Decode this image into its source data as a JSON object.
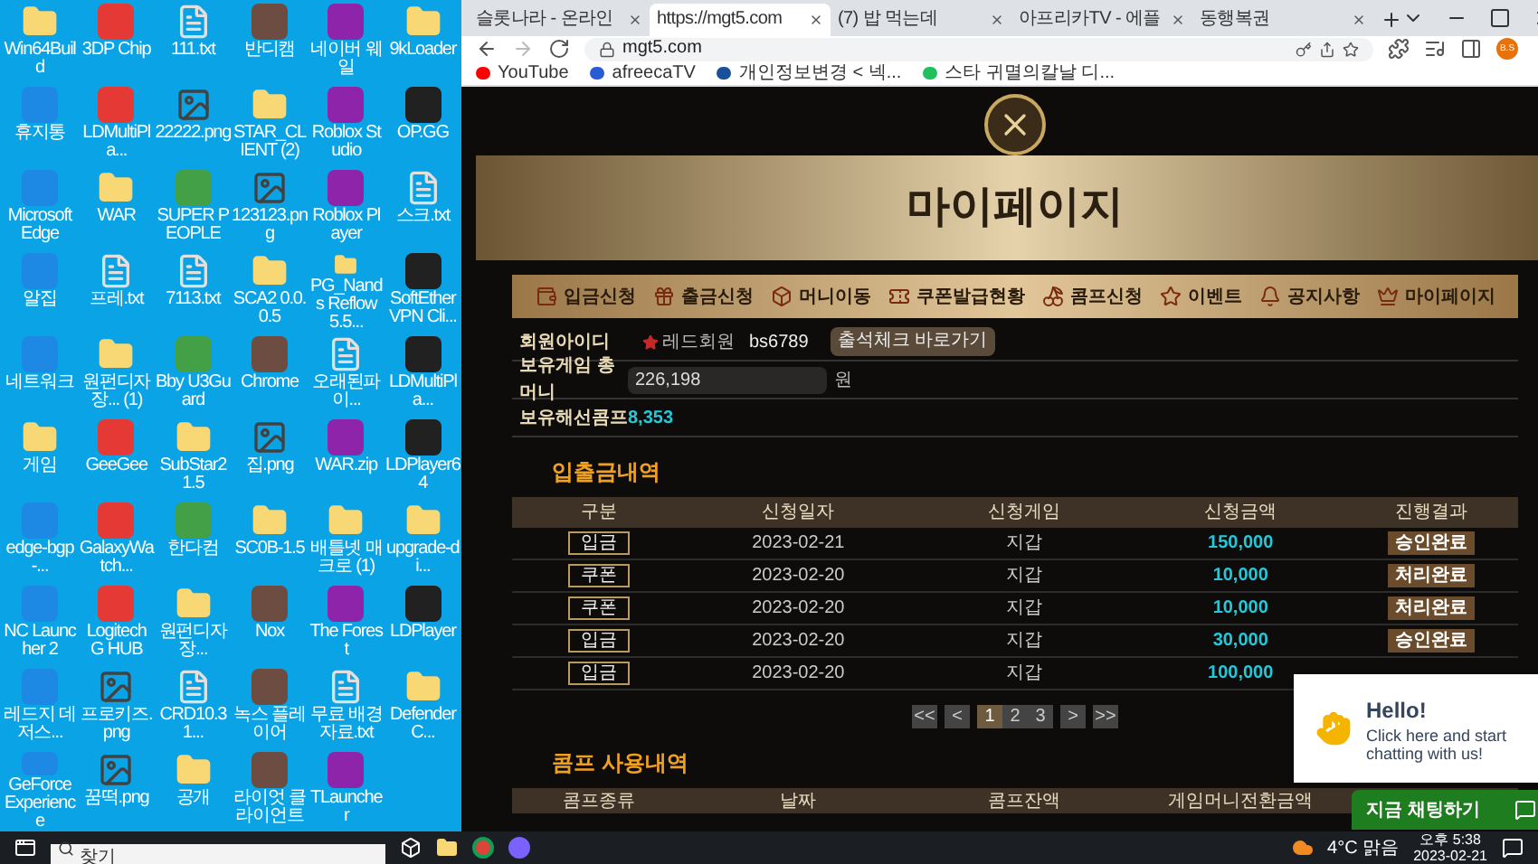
{
  "desktop": {
    "icons": [
      {
        "label": "Win64Build",
        "kind": "folder"
      },
      {
        "label": "3DP Chip",
        "kind": "app"
      },
      {
        "label": "111.txt",
        "kind": "file"
      },
      {
        "label": "반디캠",
        "kind": "app"
      },
      {
        "label": "네이버 웨일",
        "kind": "app"
      },
      {
        "label": "9kLoader",
        "kind": "folder"
      },
      {
        "label": "휴지통",
        "kind": "app"
      },
      {
        "label": "LDMultiPla...",
        "kind": "app"
      },
      {
        "label": "22222.png",
        "kind": "image"
      },
      {
        "label": "STAR_CLIENT (2)",
        "kind": "folder"
      },
      {
        "label": "Roblox Studio",
        "kind": "app"
      },
      {
        "label": "OP.GG",
        "kind": "app"
      },
      {
        "label": "Microsoft Edge",
        "kind": "app"
      },
      {
        "label": "WAR",
        "kind": "folder"
      },
      {
        "label": "SUPER PEOPLE",
        "kind": "app"
      },
      {
        "label": "123123.png",
        "kind": "image"
      },
      {
        "label": "Roblox Player",
        "kind": "app"
      },
      {
        "label": "스크.txt",
        "kind": "file"
      },
      {
        "label": "알집",
        "kind": "app"
      },
      {
        "label": "프레.txt",
        "kind": "file"
      },
      {
        "label": "7113.txt",
        "kind": "file"
      },
      {
        "label": "SCA2 0.0.0.5",
        "kind": "folder"
      },
      {
        "label": "PG_Nands Reflow 5.5...",
        "kind": "folder"
      },
      {
        "label": "SoftEther VPN Cli...",
        "kind": "app"
      },
      {
        "label": "네트워크",
        "kind": "app"
      },
      {
        "label": "원펀디자장... (1)",
        "kind": "folder"
      },
      {
        "label": "Bby U3Guard",
        "kind": "app"
      },
      {
        "label": "Chrome",
        "kind": "app"
      },
      {
        "label": "오래된파이...",
        "kind": "file"
      },
      {
        "label": "LDMultiPla...",
        "kind": "app"
      },
      {
        "label": "게임",
        "kind": "folder"
      },
      {
        "label": "GeeGee",
        "kind": "app"
      },
      {
        "label": "SubStar2 1.5",
        "kind": "folder"
      },
      {
        "label": "집.png",
        "kind": "image"
      },
      {
        "label": "WAR.zip",
        "kind": "app"
      },
      {
        "label": "LDPlayer64",
        "kind": "app"
      },
      {
        "label": "edge-bgp-...",
        "kind": "app"
      },
      {
        "label": "GalaxyWatch...",
        "kind": "app"
      },
      {
        "label": "한다컴",
        "kind": "app"
      },
      {
        "label": "SC0B-1.5",
        "kind": "folder"
      },
      {
        "label": "배틀넷 매크로 (1)",
        "kind": "folder"
      },
      {
        "label": "upgrade-di...",
        "kind": "folder"
      },
      {
        "label": "NC Launcher 2",
        "kind": "app"
      },
      {
        "label": "Logitech G HUB",
        "kind": "app"
      },
      {
        "label": "원펀디자장...",
        "kind": "folder"
      },
      {
        "label": "Nox",
        "kind": "app"
      },
      {
        "label": "The Forest",
        "kind": "app"
      },
      {
        "label": "LDPlayer",
        "kind": "app"
      },
      {
        "label": "레드지 데저스...",
        "kind": "app"
      },
      {
        "label": "프로키즈.png",
        "kind": "image"
      },
      {
        "label": "CRD10.31...",
        "kind": "file"
      },
      {
        "label": "녹스 플레이어",
        "kind": "app"
      },
      {
        "label": "무료 배경자료.txt",
        "kind": "file"
      },
      {
        "label": "DefenderC...",
        "kind": "folder"
      },
      {
        "label": "GeForce Experience",
        "kind": "app"
      },
      {
        "label": "꿈떡.png",
        "kind": "image"
      },
      {
        "label": "공개",
        "kind": "folder"
      },
      {
        "label": "라이엇 클라이언트",
        "kind": "app"
      },
      {
        "label": "TLauncher",
        "kind": "app"
      }
    ]
  },
  "browser": {
    "tabs": [
      {
        "title": "슬롯나라 - 온라인",
        "selected": false
      },
      {
        "title": "https://mgt5.com",
        "selected": true
      },
      {
        "title": "(7) 밥 먹는데",
        "selected": false
      },
      {
        "title": "아프리카TV - 에플",
        "selected": false
      },
      {
        "title": "동행복권",
        "selected": false
      }
    ],
    "address": "mgt5.com",
    "profile": "B.S",
    "bookmarks": [
      "YouTube",
      "afreecaTV",
      "개인정보변경 < 넥...",
      "스타 귀멸의칼날 디..."
    ]
  },
  "page": {
    "title": "마이페이지",
    "nav": [
      {
        "label": "입금신청"
      },
      {
        "label": "출금신청"
      },
      {
        "label": "머니이동"
      },
      {
        "label": "쿠폰발급현황"
      },
      {
        "label": "콤프신청"
      },
      {
        "label": "이벤트"
      },
      {
        "label": "공지사항"
      },
      {
        "label": "마이페이지"
      }
    ],
    "info": {
      "id_label": "회원아이디",
      "grade": "레드회원",
      "user_id": "bs6789",
      "attendance_button": "출석체크 바로가기",
      "money_label": "보유게임 총머니",
      "money": "226,198",
      "money_unit": "원",
      "comp_label": "보유해선콤프",
      "comp": "8,353"
    },
    "history": {
      "title": "입출금내역",
      "columns": [
        "구분",
        "신청일자",
        "신청게임",
        "신청금액",
        "진행결과"
      ],
      "rows": [
        {
          "type": "입금",
          "date": "2023-02-21",
          "game": "지갑",
          "amount": "150,000",
          "status": "승인완료"
        },
        {
          "type": "쿠폰",
          "date": "2023-02-20",
          "game": "지갑",
          "amount": "10,000",
          "status": "처리완료"
        },
        {
          "type": "쿠폰",
          "date": "2023-02-20",
          "game": "지갑",
          "amount": "10,000",
          "status": "처리완료"
        },
        {
          "type": "입금",
          "date": "2023-02-20",
          "game": "지갑",
          "amount": "30,000",
          "status": "승인완료"
        },
        {
          "type": "입금",
          "date": "2023-02-20",
          "game": "지갑",
          "amount": "100,000"
        }
      ],
      "pagination": {
        "first": "<<",
        "prev": "<",
        "pages": [
          {
            "label": "1",
            "selected": true
          },
          {
            "label": "2",
            "selected": false
          },
          {
            "label": "3",
            "selected": false
          }
        ],
        "next": ">",
        "last": ">>"
      }
    },
    "comp": {
      "title": "콤프 사용내역",
      "columns": [
        "콤프종류",
        "날짜",
        "콤프잔액",
        "게임머니전환금액"
      ]
    }
  },
  "chat": {
    "title": "Hello!",
    "text": "Click here and start chatting with us!",
    "button": "지금 채팅하기"
  },
  "taskbar": {
    "search_placeholder": "찾기",
    "weather": "4°C 맑음",
    "time": "오후 5:38",
    "date": "2023-02-21"
  }
}
